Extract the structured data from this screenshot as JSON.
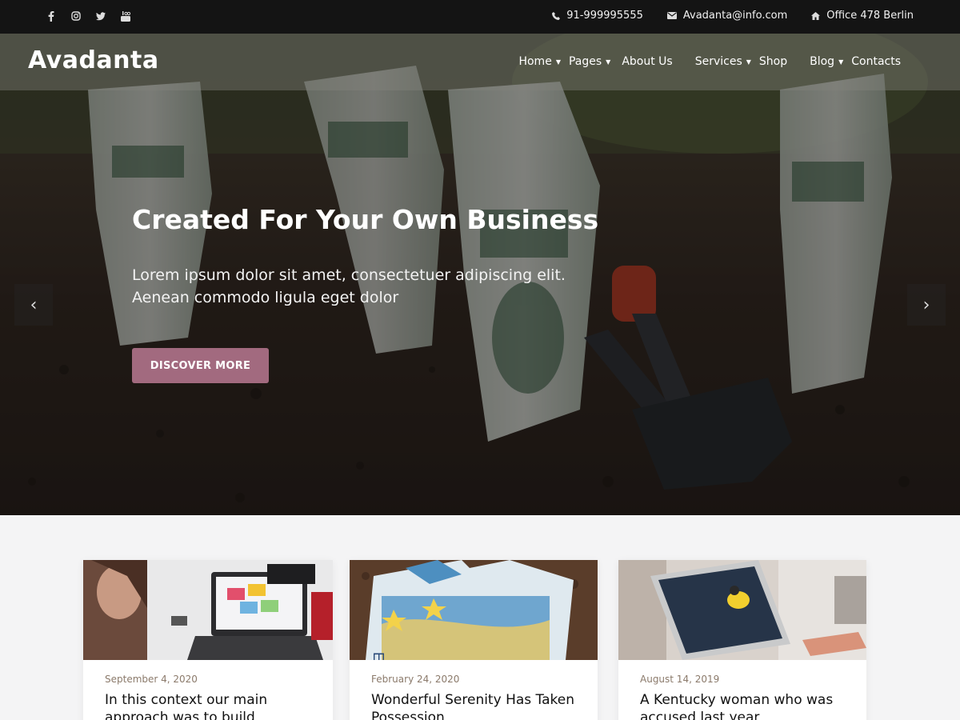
{
  "topbar": {
    "social": [
      "facebook-icon",
      "instagram-icon",
      "twitter-icon",
      "youtube-icon"
    ],
    "phone": "91-999995555",
    "email": "Avadanta@info.com",
    "address": "Office 478 Berlin"
  },
  "nav": {
    "logo": "Avadanta",
    "items": [
      {
        "label": "Home",
        "dropdown": true
      },
      {
        "label": "Pages",
        "dropdown": true
      },
      {
        "label": "About Us",
        "dropdown": false
      },
      {
        "label": "Services",
        "dropdown": true
      },
      {
        "label": "Shop",
        "dropdown": false
      },
      {
        "label": "Blog",
        "dropdown": true
      },
      {
        "label": "Contacts",
        "dropdown": false
      }
    ]
  },
  "hero": {
    "title": "Created For Your Own Business",
    "text_line1": "Lorem ipsum dolor sit amet, consectetuer adipiscing elit.",
    "text_line2": "Aenean commodo ligula eget dolor",
    "button": "DISCOVER MORE",
    "arrow_prev": "‹",
    "arrow_next": "›"
  },
  "posts": [
    {
      "date": "September 4, 2020",
      "title": "In this context our main approach was to build"
    },
    {
      "date": "February 24, 2020",
      "title": "Wonderful Serenity Has Taken Possession"
    },
    {
      "date": "August 14, 2019",
      "title": "A Kentucky woman who was accused last year"
    }
  ],
  "colors": {
    "accent": "#a26a7f",
    "topbar": "#141414"
  }
}
